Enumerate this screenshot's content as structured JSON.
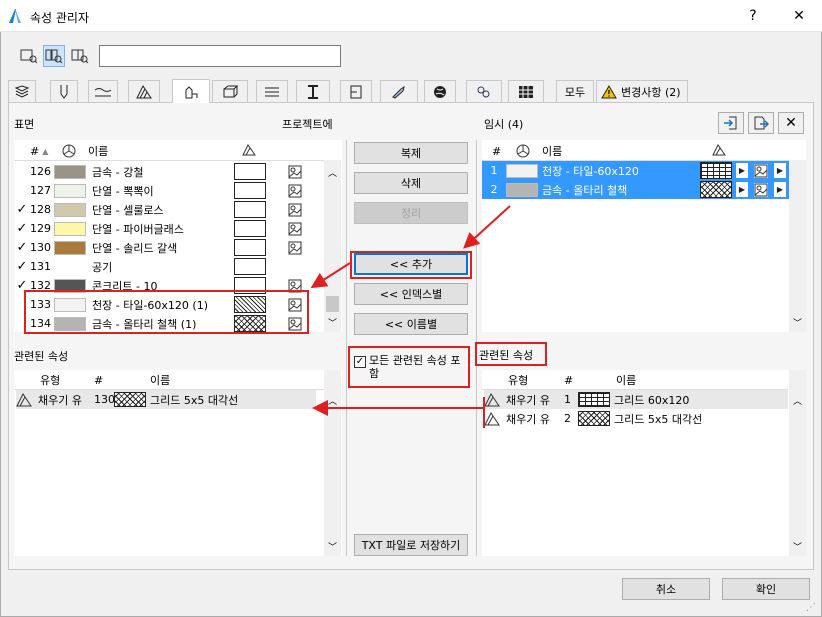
{
  "window": {
    "title": "속성 관리자",
    "help": "?",
    "close": "✕"
  },
  "tabs": [
    {
      "label": ""
    },
    {
      "label": ""
    },
    {
      "label": ""
    },
    {
      "label": ""
    },
    {
      "label": ""
    },
    {
      "label": ""
    },
    {
      "label": ""
    },
    {
      "label": ""
    },
    {
      "label": ""
    },
    {
      "label": ""
    },
    {
      "label": ""
    },
    {
      "label": ""
    },
    {
      "label": ""
    },
    {
      "label": "모두"
    },
    {
      "label": "변경사항 (2)"
    }
  ],
  "left": {
    "section_title": "표면",
    "project_label": "프로젝트에",
    "header": {
      "num": "#",
      "name": "이름"
    },
    "rows": [
      {
        "check": "",
        "num": "126",
        "color": "#9a9488",
        "name": "금속 - 강철"
      },
      {
        "check": "",
        "num": "127",
        "color": "#eef3ea",
        "name": "단열 - 뽁뽁이"
      },
      {
        "check": "✓",
        "num": "128",
        "color": "#cfc9ae",
        "name": "단열 - 셀룰로스"
      },
      {
        "check": "✓",
        "num": "129",
        "color": "#fdf7a8",
        "name": "단열 - 파이버글래스"
      },
      {
        "check": "✓",
        "num": "130",
        "color": "#a87a3e",
        "name": "단열 - 솔리드 갈색"
      },
      {
        "check": "✓",
        "num": "131",
        "color": "",
        "name": "공기"
      },
      {
        "check": "✓",
        "num": "132",
        "color": "#555555",
        "name": "콘크리트 - 10"
      },
      {
        "check": "",
        "num": "133",
        "color": "#f2f2f2",
        "name": "천장 - 타일-60x120 (1)"
      },
      {
        "check": "",
        "num": "134",
        "color": "#b4b4b4",
        "name": "금속 - 올타리 철책 (1)"
      }
    ],
    "related_title": "관련된 속성",
    "related_header": {
      "type": "유형",
      "num": "#",
      "name": "이름"
    },
    "related_rows": [
      {
        "type": "채우기 유",
        "num": "130",
        "name": "그리드 5x5 대각선"
      }
    ]
  },
  "middle": {
    "copy": "복제",
    "delete": "삭제",
    "arrange": "정리",
    "add": "<< 추가",
    "by_index": "<< 인덱스별",
    "by_name": "<< 이름별",
    "include_related": "모든 관련된 속성 포함",
    "save_txt": "TXT 파일로 저장하기"
  },
  "right": {
    "section_title": "임시 (4)",
    "header": {
      "num": "#",
      "name": "이름"
    },
    "rows": [
      {
        "num": "1",
        "color": "#f2f2f2",
        "name": "천장 - 타일-60x120"
      },
      {
        "num": "2",
        "color": "#b4b4b4",
        "name": "금속 - 올타리 철책"
      }
    ],
    "related_title": "관련된 속성",
    "related_header": {
      "type": "유형",
      "num": "#",
      "name": "이름"
    },
    "related_rows": [
      {
        "type": "채우기 유",
        "num": "1",
        "name": "그리드 60x120"
      },
      {
        "type": "채우기 유",
        "num": "2",
        "name": "그리드 5x5 대각선"
      }
    ]
  },
  "footer": {
    "cancel": "취소",
    "ok": "확인"
  },
  "colors": {
    "selection": "#3399ff",
    "annotation": "#e02020",
    "focus": "#0078d7"
  }
}
